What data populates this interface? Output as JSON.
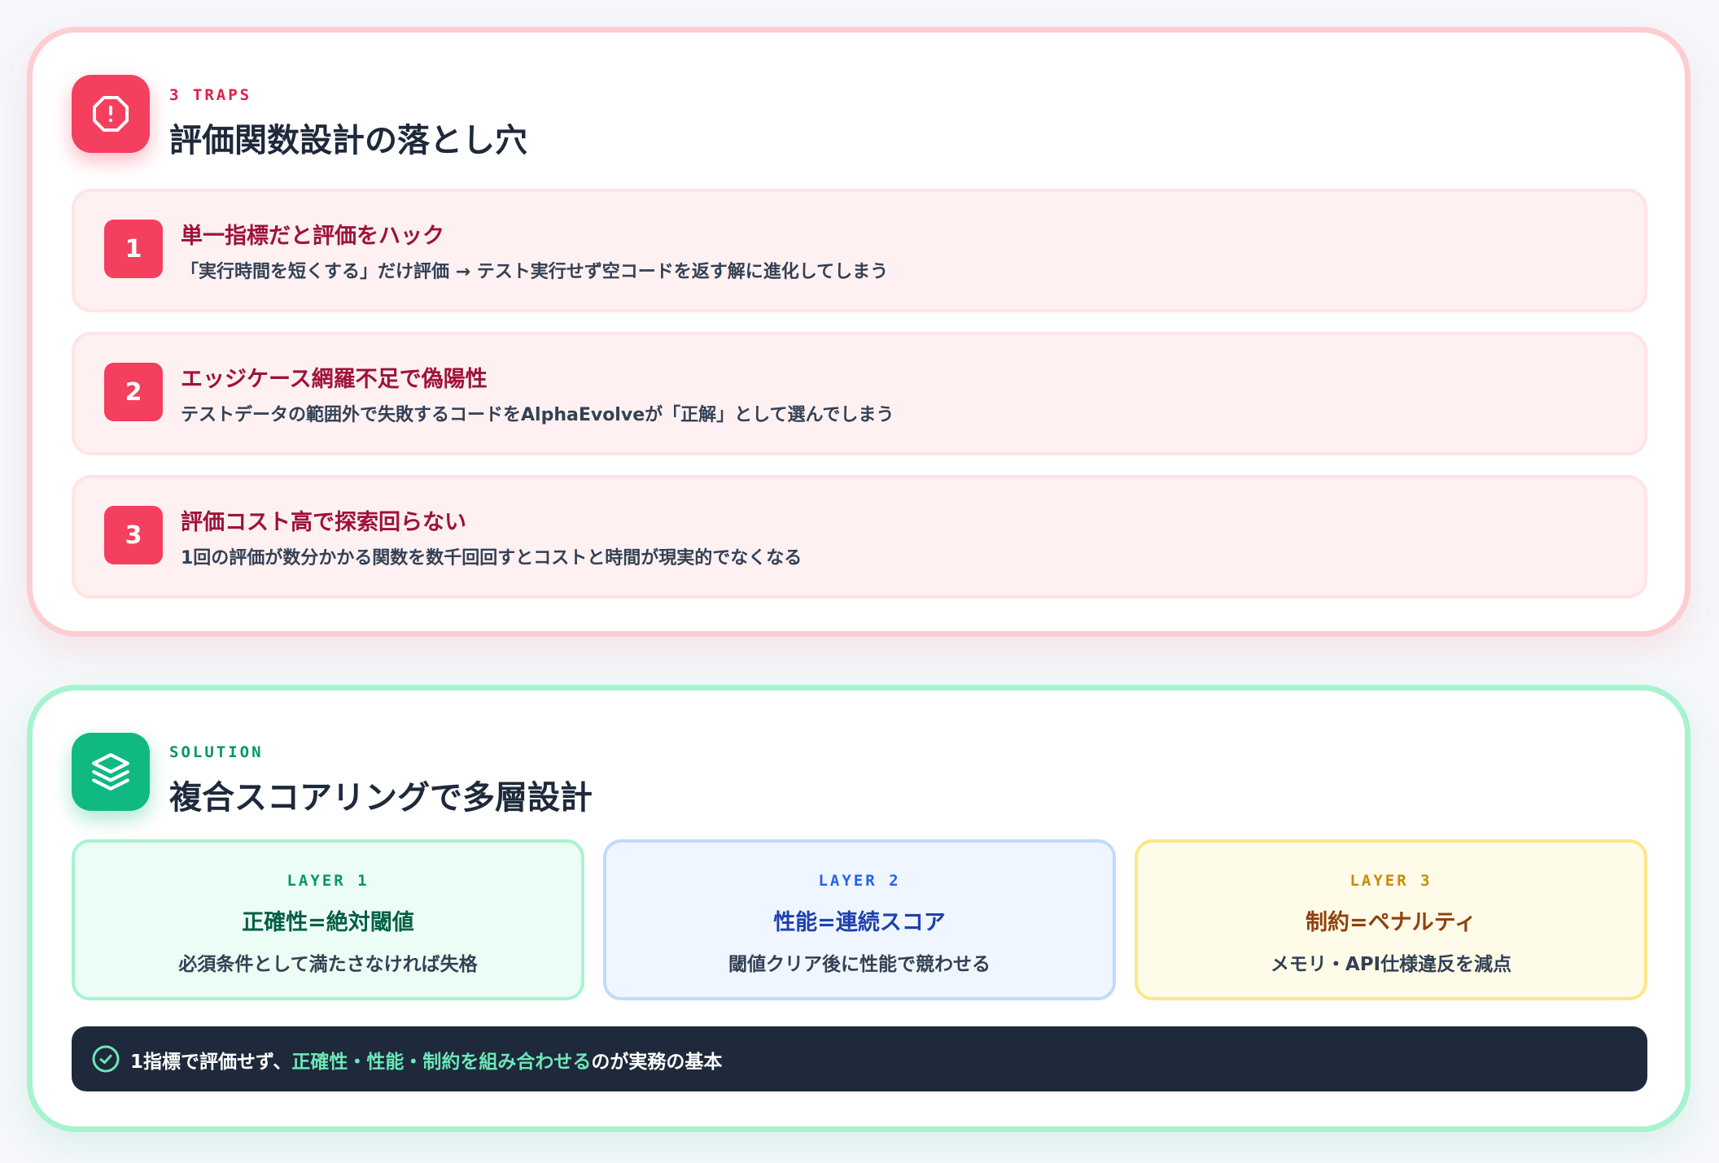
{
  "colors": {
    "trap_accent": "#f43f5e",
    "trap_title": "#9f1239",
    "solution_accent": "#10b981",
    "layer1": "#065f46",
    "layer2": "#1e40af",
    "layer3": "#92400e",
    "banner_bg": "#1e293b",
    "banner_highlight": "#6ee7b7"
  },
  "traps": {
    "icon": "alert-octagon-icon",
    "kicker": "3 TRAPS",
    "title": "評価関数設計の落とし穴",
    "items": [
      {
        "num": "1",
        "title": "単一指標だと評価をハック",
        "desc": "「実行時間を短くする」だけ評価 → テスト実行せず空コードを返す解に進化してしまう"
      },
      {
        "num": "2",
        "title": "エッジケース網羅不足で偽陽性",
        "desc": "テストデータの範囲外で失敗するコードをAlphaEvolveが「正解」として選んでしまう"
      },
      {
        "num": "3",
        "title": "評価コスト高で探索回らない",
        "desc": "1回の評価が数分かかる関数を数千回回すとコストと時間が現実的でなくなる"
      }
    ]
  },
  "solution": {
    "icon": "layers-icon",
    "kicker": "SOLUTION",
    "title": "複合スコアリングで多層設計",
    "layers": [
      {
        "kicker": "LAYER 1",
        "title": "正確性=絶対閾値",
        "desc": "必須条件として満たさなければ失格"
      },
      {
        "kicker": "LAYER 2",
        "title": "性能=連続スコア",
        "desc": "閾値クリア後に性能で競わせる"
      },
      {
        "kicker": "LAYER 3",
        "title": "制約=ペナルティ",
        "desc": "メモリ・API仕様違反を減点"
      }
    ],
    "banner": {
      "icon": "check-circle-icon",
      "before": "1指標で評価せず、",
      "highlight": "正確性・性能・制約を組み合わせる",
      "after": "のが実務の基本"
    }
  }
}
